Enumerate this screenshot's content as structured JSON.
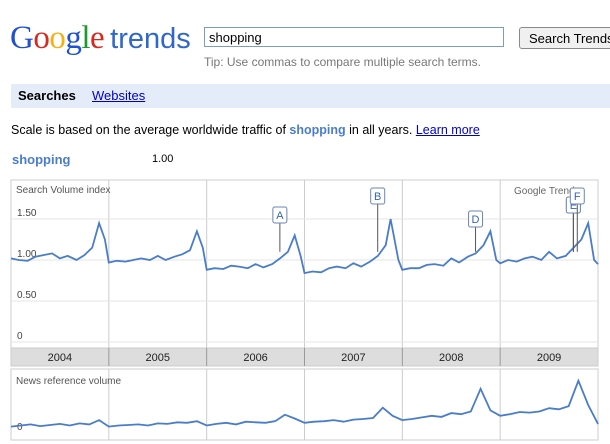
{
  "logo": {
    "google": "Google",
    "trends": "trends"
  },
  "search": {
    "value": "shopping",
    "button_label": "Search Trends",
    "tip": "Tip: Use commas to compare multiple search terms."
  },
  "tabs": {
    "searches": "Searches",
    "websites": "Websites"
  },
  "scale_note": {
    "prefix": "Scale is based on the average worldwide traffic of ",
    "term": "shopping",
    "suffix": " in all years.",
    "link": "Learn more"
  },
  "legend": {
    "term": "shopping",
    "value": "1.00"
  },
  "colors": {
    "line": "#4a7dc9",
    "grid": "#cccccc",
    "axis_band": "#dddddd"
  },
  "chart_data": {
    "type": "line",
    "title": "Search Volume index",
    "watermark": "Google Trends",
    "y_ticks": [
      "1.50",
      "1.00",
      "0.50",
      "0"
    ],
    "ylim": [
      0,
      2.0
    ],
    "x_labels": [
      "2004",
      "2005",
      "2006",
      "2007",
      "2008",
      "2009"
    ],
    "annotations": [
      {
        "label": "A",
        "x": 2006.83
      },
      {
        "label": "B",
        "x": 2007.83
      },
      {
        "label": "C",
        "x": 2009.83
      },
      {
        "label": "D",
        "x": 2008.83
      },
      {
        "label": "E",
        "x": 2009.83
      },
      {
        "label": "F",
        "x": 2009.87
      }
    ],
    "series": [
      {
        "x": [
          2004.0,
          2004.08,
          2004.17,
          2004.25,
          2004.33,
          2004.42,
          2004.5,
          2004.58,
          2004.67,
          2004.75,
          2004.83,
          2004.9,
          2004.96,
          2005.0,
          2005.08,
          2005.17,
          2005.25,
          2005.33,
          2005.42,
          2005.5,
          2005.58,
          2005.67,
          2005.75,
          2005.83,
          2005.9,
          2005.96,
          2006.0,
          2006.08,
          2006.17,
          2006.25,
          2006.33,
          2006.42,
          2006.5,
          2006.58,
          2006.67,
          2006.75,
          2006.83,
          2006.9,
          2006.96,
          2007.0,
          2007.08,
          2007.17,
          2007.25,
          2007.33,
          2007.42,
          2007.5,
          2007.58,
          2007.67,
          2007.75,
          2007.83,
          2007.88,
          2007.96,
          2008.0,
          2008.08,
          2008.17,
          2008.25,
          2008.33,
          2008.42,
          2008.5,
          2008.58,
          2008.67,
          2008.75,
          2008.83,
          2008.9,
          2008.96,
          2009.0,
          2009.08,
          2009.17,
          2009.25,
          2009.33,
          2009.42,
          2009.5,
          2009.58,
          2009.67,
          2009.75,
          2009.83,
          2009.9,
          2009.96,
          2010.0
        ],
        "values": [
          1.02,
          1.0,
          0.99,
          1.04,
          1.06,
          1.08,
          1.02,
          1.05,
          1.0,
          1.06,
          1.15,
          1.45,
          1.25,
          0.97,
          0.99,
          0.98,
          1.0,
          1.02,
          1.0,
          1.05,
          1.0,
          1.04,
          1.07,
          1.12,
          1.35,
          1.15,
          0.88,
          0.9,
          0.89,
          0.93,
          0.92,
          0.9,
          0.95,
          0.91,
          0.95,
          1.02,
          1.1,
          1.3,
          1.05,
          0.84,
          0.86,
          0.85,
          0.9,
          0.92,
          0.9,
          0.96,
          0.92,
          0.98,
          1.05,
          1.18,
          1.5,
          1.0,
          0.88,
          0.9,
          0.9,
          0.94,
          0.95,
          0.93,
          1.02,
          0.97,
          1.04,
          1.08,
          1.18,
          1.35,
          1.0,
          0.96,
          1.0,
          0.98,
          1.02,
          1.04,
          1.0,
          1.1,
          1.02,
          1.05,
          1.15,
          1.25,
          1.45,
          1.0,
          0.95
        ]
      }
    ],
    "news": {
      "title": "News reference volume",
      "y_ticks": [
        "0"
      ],
      "ylim": [
        0,
        1.0
      ],
      "x": [
        2004.0,
        2004.1,
        2004.2,
        2004.3,
        2004.4,
        2004.5,
        2004.6,
        2004.7,
        2004.8,
        2004.9,
        2005.0,
        2005.1,
        2005.2,
        2005.3,
        2005.4,
        2005.5,
        2005.6,
        2005.7,
        2005.8,
        2005.9,
        2006.0,
        2006.1,
        2006.2,
        2006.3,
        2006.4,
        2006.5,
        2006.6,
        2006.7,
        2006.8,
        2006.9,
        2007.0,
        2007.1,
        2007.2,
        2007.3,
        2007.4,
        2007.5,
        2007.6,
        2007.7,
        2007.8,
        2007.9,
        2008.0,
        2008.1,
        2008.2,
        2008.3,
        2008.4,
        2008.5,
        2008.6,
        2008.7,
        2008.8,
        2008.9,
        2009.0,
        2009.1,
        2009.2,
        2009.3,
        2009.4,
        2009.5,
        2009.6,
        2009.7,
        2009.8,
        2009.9,
        2010.0
      ],
      "values": [
        0.1,
        0.12,
        0.14,
        0.11,
        0.13,
        0.15,
        0.12,
        0.16,
        0.14,
        0.22,
        0.1,
        0.12,
        0.13,
        0.14,
        0.12,
        0.16,
        0.15,
        0.18,
        0.17,
        0.2,
        0.12,
        0.15,
        0.17,
        0.14,
        0.19,
        0.18,
        0.17,
        0.2,
        0.32,
        0.25,
        0.17,
        0.19,
        0.2,
        0.22,
        0.19,
        0.23,
        0.24,
        0.26,
        0.45,
        0.3,
        0.22,
        0.24,
        0.27,
        0.3,
        0.28,
        0.35,
        0.33,
        0.38,
        0.8,
        0.4,
        0.3,
        0.33,
        0.37,
        0.36,
        0.38,
        0.44,
        0.42,
        0.48,
        0.95,
        0.5,
        0.15
      ]
    }
  }
}
